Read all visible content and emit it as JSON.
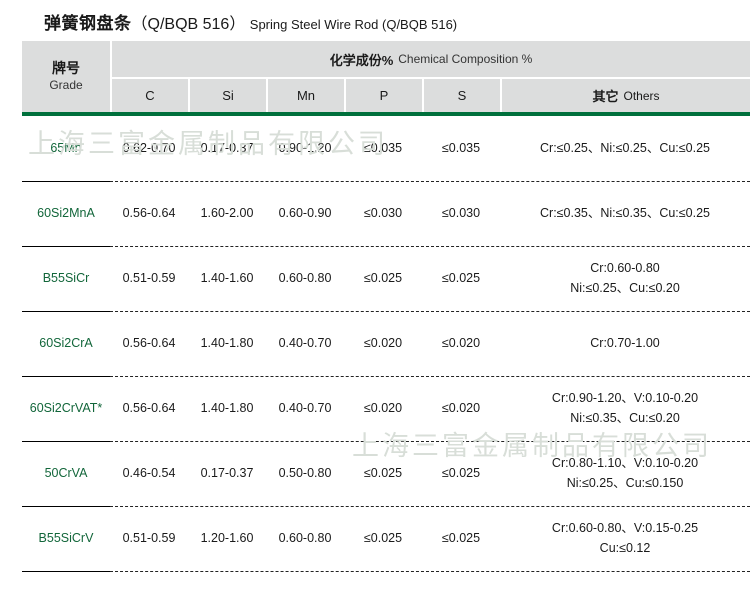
{
  "title": {
    "chinese": "弹簧钢盘条",
    "standard": "（Q/BQB 516）",
    "english": "Spring Steel Wire Rod (Q/BQB 516)"
  },
  "watermark": {
    "text": "上海三富金属制品有限公司"
  },
  "colors": {
    "accent_green": "#00703c",
    "header_bg": "#dcdddd",
    "grade_text": "#12663a",
    "body_text": "#1a1a1a",
    "watermark": "#d8ded8"
  },
  "table": {
    "header": {
      "grade_cn": "牌号",
      "grade_en": "Grade",
      "group_cn": "化学成份%",
      "group_en": "Chemical Composition %",
      "columns": [
        {
          "label": "C"
        },
        {
          "label": "Si"
        },
        {
          "label": "Mn"
        },
        {
          "label": "P"
        },
        {
          "label": "S"
        }
      ],
      "others_cn": "其它",
      "others_en": "Others"
    },
    "rows": [
      {
        "grade": "65Mn",
        "c": "0.62-0.70",
        "si": "0.17-0.37",
        "mn": "0.90-1.20",
        "p": "≤0.035",
        "s": "≤0.035",
        "others": [
          "Cr:≤0.25、Ni:≤0.25、Cu:≤0.25"
        ]
      },
      {
        "grade": "60Si2MnA",
        "c": "0.56-0.64",
        "si": "1.60-2.00",
        "mn": "0.60-0.90",
        "p": "≤0.030",
        "s": "≤0.030",
        "others": [
          "Cr:≤0.35、Ni:≤0.35、Cu:≤0.25"
        ]
      },
      {
        "grade": "B55SiCr",
        "c": "0.51-0.59",
        "si": "1.40-1.60",
        "mn": "0.60-0.80",
        "p": "≤0.025",
        "s": "≤0.025",
        "others": [
          "Cr:0.60-0.80",
          "Ni:≤0.25、Cu:≤0.20"
        ]
      },
      {
        "grade": "60Si2CrA",
        "c": "0.56-0.64",
        "si": "1.40-1.80",
        "mn": "0.40-0.70",
        "p": "≤0.020",
        "s": "≤0.020",
        "others": [
          "Cr:0.70-1.00"
        ]
      },
      {
        "grade": "60Si2CrVAT*",
        "c": "0.56-0.64",
        "si": "1.40-1.80",
        "mn": "0.40-0.70",
        "p": "≤0.020",
        "s": "≤0.020",
        "others": [
          "Cr:0.90-1.20、V:0.10-0.20",
          "Ni:≤0.35、Cu:≤0.20"
        ]
      },
      {
        "grade": "50CrVA",
        "c": "0.46-0.54",
        "si": "0.17-0.37",
        "mn": "0.50-0.80",
        "p": "≤0.025",
        "s": "≤0.025",
        "others": [
          "Cr:0.80-1.10、V:0.10-0.20",
          "Ni:≤0.25、Cu:≤0.150"
        ]
      },
      {
        "grade": "B55SiCrV",
        "c": "0.51-0.59",
        "si": "1.20-1.60",
        "mn": "0.60-0.80",
        "p": "≤0.025",
        "s": "≤0.025",
        "others": [
          "Cr:0.60-0.80、V:0.15-0.25",
          "Cu:≤0.12"
        ]
      }
    ]
  }
}
